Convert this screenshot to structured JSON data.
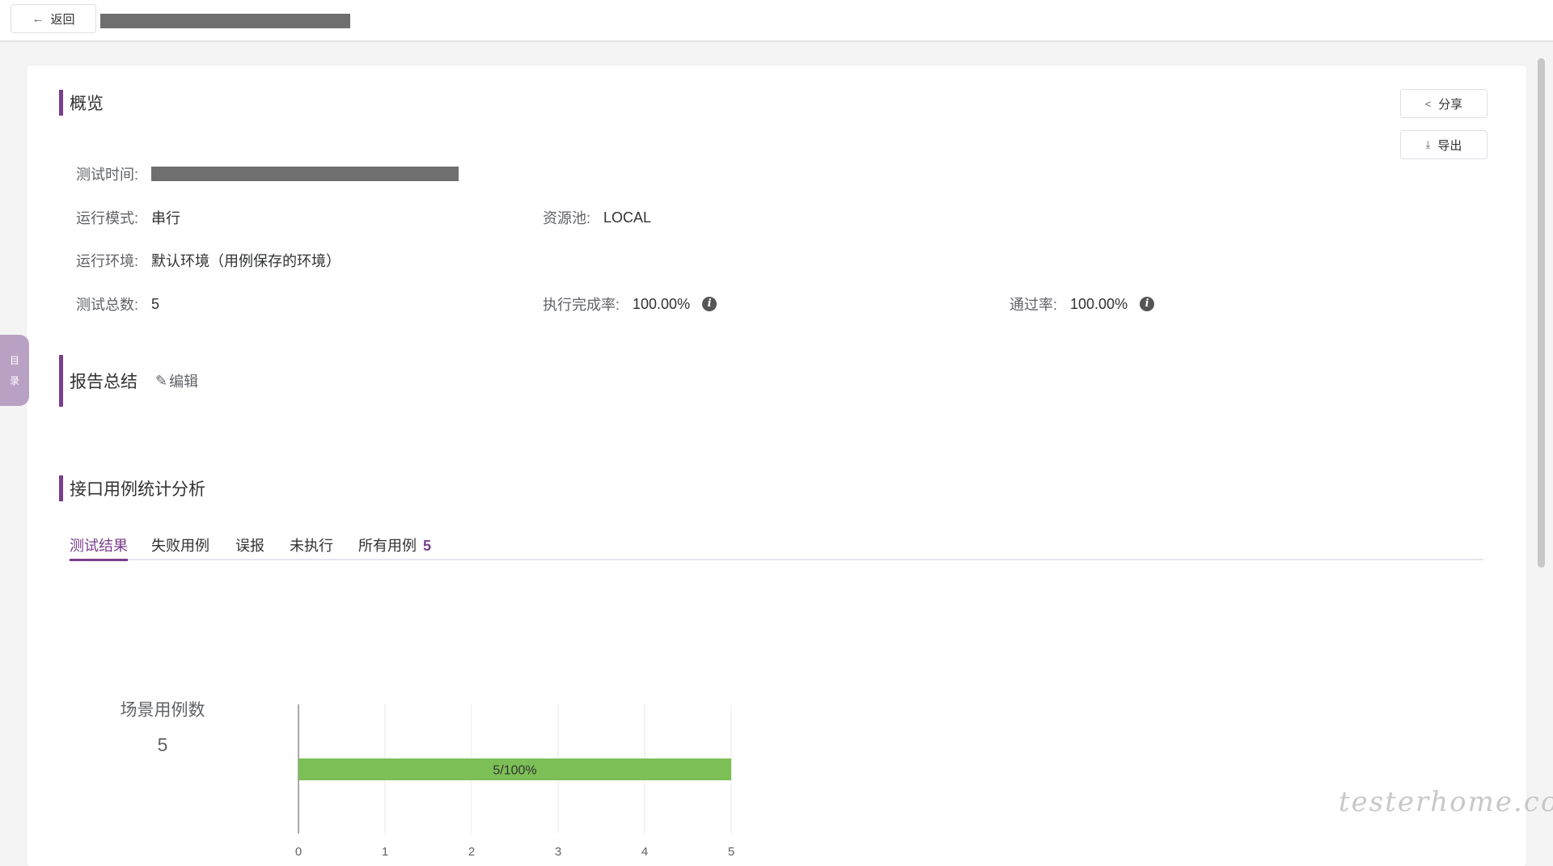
{
  "header": {
    "back_label": "返回",
    "back_icon": "arrow-left-icon"
  },
  "overview": {
    "title": "概览",
    "share_label": "分享",
    "export_label": "导出",
    "test_time_label": "测试时间:",
    "run_mode_label": "运行模式:",
    "run_mode_value": "串行",
    "resource_pool_label": "资源池:",
    "resource_pool_value": "LOCAL",
    "run_env_label": "运行环境:",
    "run_env_value": "默认环境（用例保存的环境）",
    "total_label": "测试总数:",
    "total_value": "5",
    "completion_label": "执行完成率:",
    "completion_value": "100.00%",
    "pass_label": "通过率:",
    "pass_value": "100.00%"
  },
  "summary": {
    "title": "报告总结",
    "edit_label": "编辑"
  },
  "analysis": {
    "title": "接口用例统计分析",
    "tabs": [
      {
        "label": "测试结果"
      },
      {
        "label": "失败用例"
      },
      {
        "label": "误报"
      },
      {
        "label": "未执行"
      },
      {
        "label": "所有用例",
        "count": "5"
      }
    ],
    "active_tab": 0
  },
  "chart_data": {
    "type": "bar",
    "orientation": "horizontal",
    "title": "场景用例数",
    "total": "5",
    "categories": [
      ""
    ],
    "values": [
      5
    ],
    "bar_label": "5/100%",
    "bar_color": "#7cbf56",
    "xlim": [
      0,
      5
    ],
    "xticks": [
      "0",
      "1",
      "2",
      "3",
      "4",
      "5"
    ],
    "grid": true
  },
  "sidebar_tab": {
    "chars": [
      "目",
      "录"
    ]
  },
  "watermark": "testerhome.com",
  "colors": {
    "accent": "#7a3e8c",
    "bar_green": "#7cbf56"
  }
}
